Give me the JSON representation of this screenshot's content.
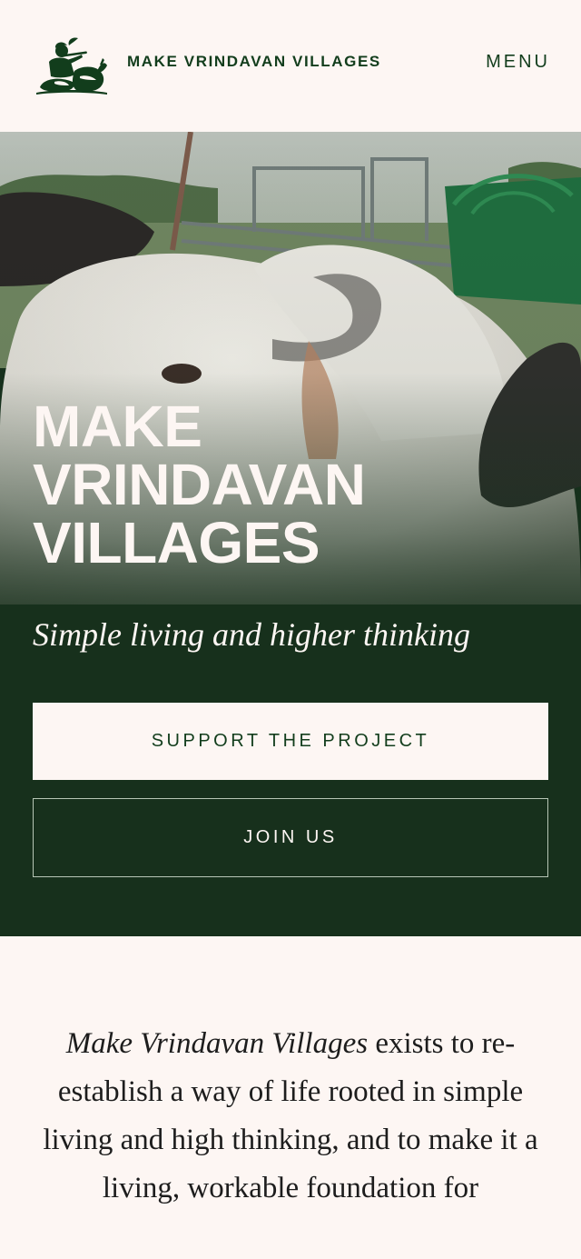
{
  "header": {
    "brand": "MAKE VRINDAVAN VILLAGES",
    "menu_label": "MENU",
    "logo_icon": "krishna-with-cow-logo-icon"
  },
  "hero": {
    "title": "MAKE VRINDAVAN VILLAGES",
    "subtitle": "Simple living and higher thinking",
    "primary_button": "SUPPORT THE PROJECT",
    "secondary_button": "JOIN US"
  },
  "intro": {
    "emphasis": "Make Vrindavan Villages",
    "text": " exists to re-establish a way of life rooted in simple living and high thinking, and to make it a living, workable foundation for"
  },
  "colors": {
    "brand_green": "#123d1c",
    "hero_dark": "#16301c",
    "cream": "#fdf6f3"
  }
}
